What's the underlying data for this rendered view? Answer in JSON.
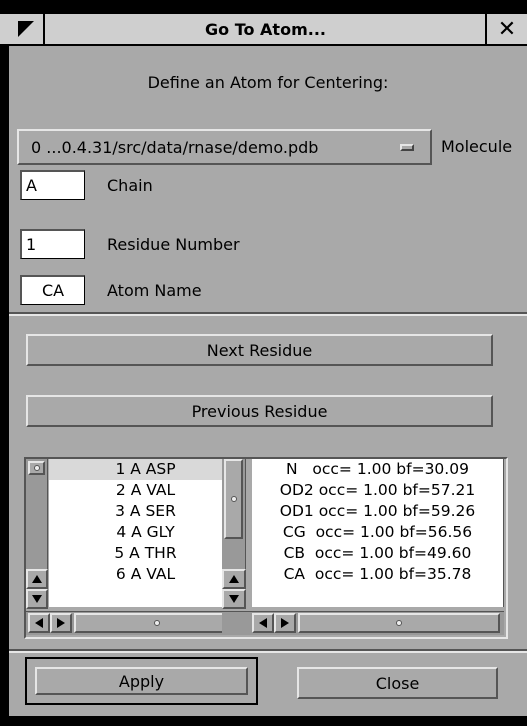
{
  "window": {
    "title": "Go To Atom...",
    "close_glyph": "✕"
  },
  "heading": "Define an Atom for Centering:",
  "molecule": {
    "selected": "0 ...0.4.31/src/data/rnase/demo.pdb",
    "label": "Molecule"
  },
  "fields": {
    "chain": {
      "value": "A",
      "label": "Chain"
    },
    "residue_number": {
      "value": "1",
      "label": "Residue Number"
    },
    "atom_name": {
      "value": "CA",
      "label": "Atom Name"
    }
  },
  "buttons": {
    "next_residue": "Next Residue",
    "previous_residue": "Previous Residue",
    "apply": "Apply",
    "close": "Close"
  },
  "residue_list": [
    "1 A ASP",
    "2 A VAL",
    "3 A SER",
    "4 A GLY",
    "5 A THR",
    "6 A VAL"
  ],
  "atom_list": [
    "N   occ= 1.00 bf=30.09",
    "OD2 occ= 1.00 bf=57.21",
    "OD1 occ= 1.00 bf=59.26",
    "CG  occ= 1.00 bf=56.56",
    "CB  occ= 1.00 bf=49.60",
    "CA  occ= 1.00 bf=35.78"
  ],
  "icons": {
    "window_menu": "triangle-menu-icon",
    "option_indicator": "option-menu-indicator-icon",
    "scroll_up": "arrow-up-icon",
    "scroll_down": "arrow-down-icon",
    "scroll_left": "arrow-left-icon",
    "scroll_right": "arrow-right-icon"
  }
}
